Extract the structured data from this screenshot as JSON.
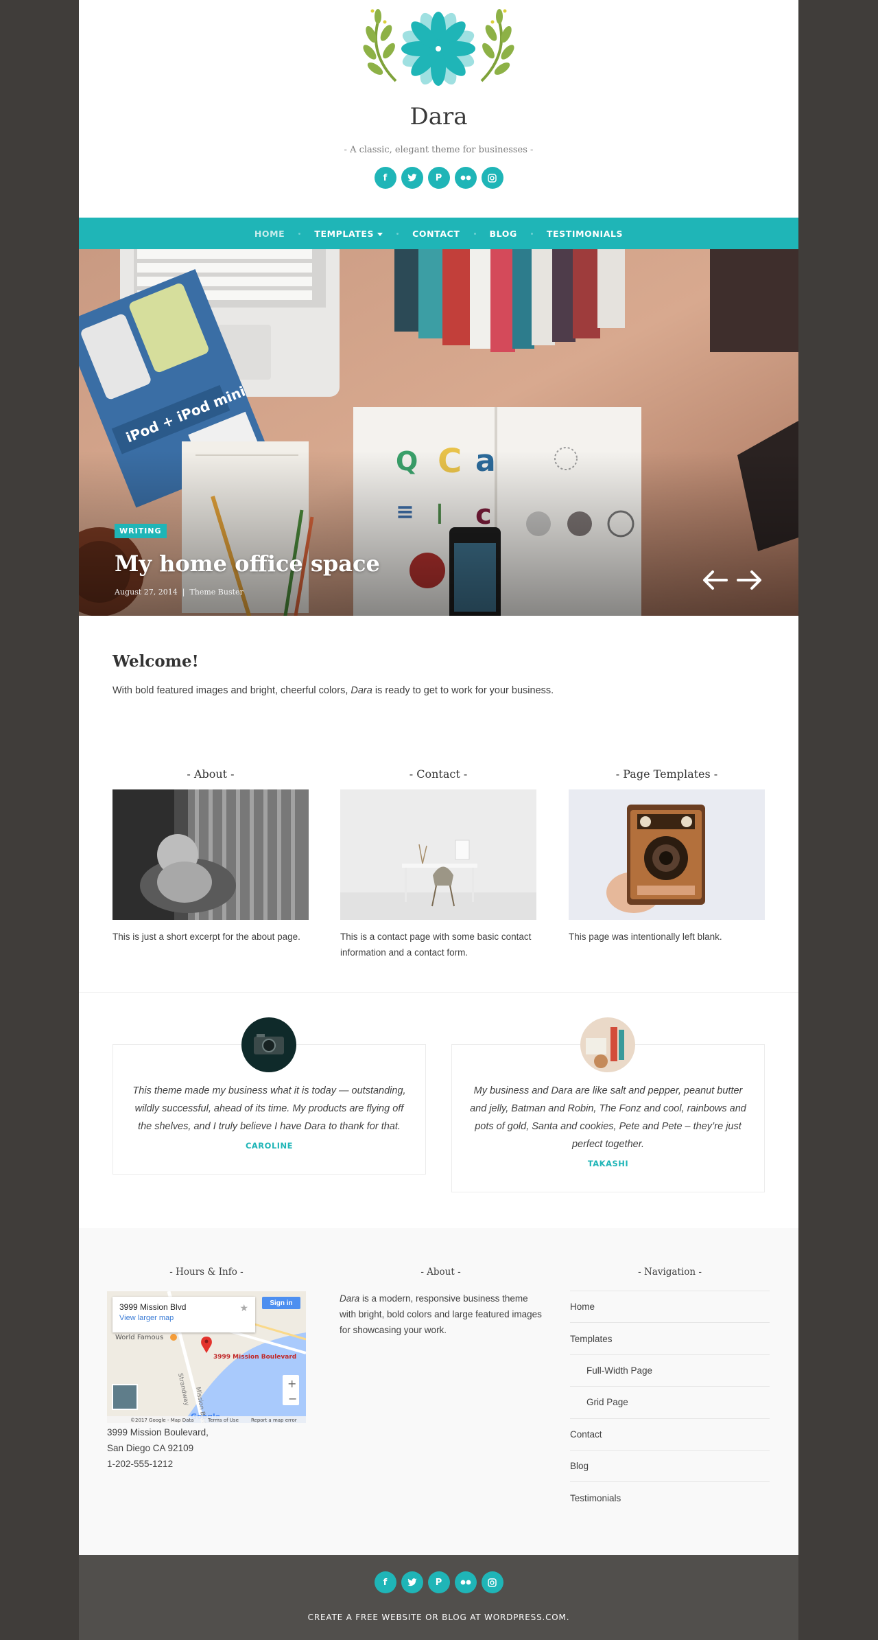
{
  "site": {
    "title": "Dara",
    "tagline": "- A classic, elegant theme for businesses -",
    "social": [
      "facebook-icon",
      "twitter-icon",
      "pinterest-icon",
      "flickr-icon",
      "instagram-icon"
    ]
  },
  "nav": {
    "items": [
      "Home",
      "Templates",
      "Contact",
      "Blog",
      "Testimonials"
    ],
    "active": "Home"
  },
  "hero": {
    "tag": "WRITING",
    "title": "My home office space",
    "date": "August 27, 2014",
    "author": "Theme Buster",
    "separator": "|"
  },
  "welcome": {
    "title": "Welcome!",
    "text_before": "With bold featured images and bright, cheerful colors, ",
    "text_em": "Dara",
    "text_after": " is ready to get to work for your business."
  },
  "columns": [
    {
      "title": "- About -",
      "text": "This is just a short excerpt for the about page."
    },
    {
      "title": "- Contact -",
      "text": "This is a contact page with some basic contact information and a contact form."
    },
    {
      "title": "- Page Templates -",
      "text": "This page was intentionally left blank."
    }
  ],
  "testimonials": [
    {
      "quote": "This theme made my business what it is today — outstanding, wildly successful, ahead of its time. My products are flying off the shelves, and I truly believe I have Dara to thank for that.",
      "name": "CAROLINE"
    },
    {
      "quote": "My business and Dara are like salt and pepper, peanut butter and jelly, Batman and Robin, The Fonz and cool, rainbows and pots of gold, Santa and cookies, Pete and Pete – they’re just perfect together.",
      "name": "TAKASHI"
    }
  ],
  "footer_widgets": {
    "hours_title": "- Hours & Info -",
    "map": {
      "place": "3999 Mission Blvd",
      "larger_link": "View larger map",
      "sign_in": "Sign in",
      "pin_label": "3999 Mission Boulevard",
      "poi": "World Famous",
      "street1": "Strandway",
      "street2": "Mission Blvd",
      "attribution": "©2017 Google - Map Data",
      "terms": "Terms of Use",
      "report": "Report a map error",
      "google": "Google"
    },
    "address": [
      "3999 Mission Boulevard,",
      "San Diego CA 92109",
      "1-202-555-1212"
    ],
    "about_title": "- About -",
    "about_em": "Dara",
    "about_text": " is a modern, responsive business theme with bright, bold colors and large featured images for showcasing your work.",
    "nav_title": "- Navigation -",
    "nav_items": [
      {
        "label": "Home",
        "sub": false
      },
      {
        "label": "Templates",
        "sub": false
      },
      {
        "label": "Full-Width Page",
        "sub": true
      },
      {
        "label": "Grid Page",
        "sub": true
      },
      {
        "label": "Contact",
        "sub": false
      },
      {
        "label": "Blog",
        "sub": false
      },
      {
        "label": "Testimonials",
        "sub": false
      }
    ]
  },
  "footer": {
    "credit": "CREATE A FREE WEBSITE OR BLOG AT WORDPRESS.COM."
  },
  "colors": {
    "accent": "#1fb5b7",
    "background": "#403d3a",
    "footer": "#514f4c"
  }
}
